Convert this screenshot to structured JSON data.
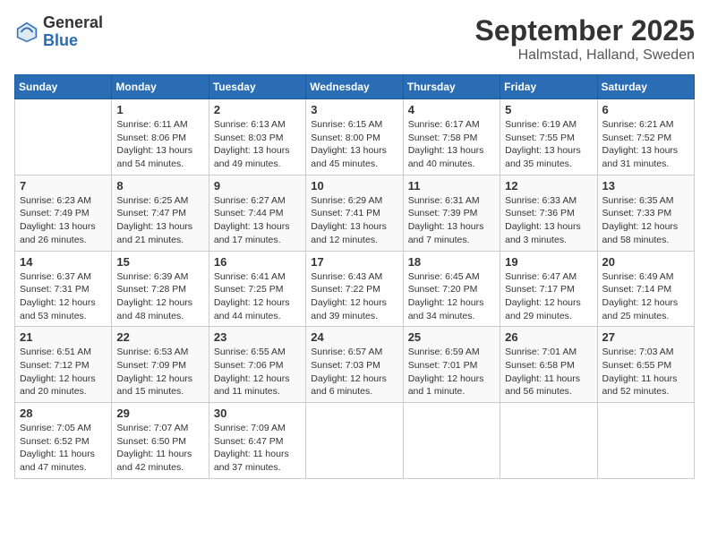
{
  "logo": {
    "general": "General",
    "blue": "Blue"
  },
  "header": {
    "month": "September 2025",
    "location": "Halmstad, Halland, Sweden"
  },
  "weekdays": [
    "Sunday",
    "Monday",
    "Tuesday",
    "Wednesday",
    "Thursday",
    "Friday",
    "Saturday"
  ],
  "weeks": [
    [
      {
        "day": "",
        "info": ""
      },
      {
        "day": "1",
        "info": "Sunrise: 6:11 AM\nSunset: 8:06 PM\nDaylight: 13 hours\nand 54 minutes."
      },
      {
        "day": "2",
        "info": "Sunrise: 6:13 AM\nSunset: 8:03 PM\nDaylight: 13 hours\nand 49 minutes."
      },
      {
        "day": "3",
        "info": "Sunrise: 6:15 AM\nSunset: 8:00 PM\nDaylight: 13 hours\nand 45 minutes."
      },
      {
        "day": "4",
        "info": "Sunrise: 6:17 AM\nSunset: 7:58 PM\nDaylight: 13 hours\nand 40 minutes."
      },
      {
        "day": "5",
        "info": "Sunrise: 6:19 AM\nSunset: 7:55 PM\nDaylight: 13 hours\nand 35 minutes."
      },
      {
        "day": "6",
        "info": "Sunrise: 6:21 AM\nSunset: 7:52 PM\nDaylight: 13 hours\nand 31 minutes."
      }
    ],
    [
      {
        "day": "7",
        "info": "Sunrise: 6:23 AM\nSunset: 7:49 PM\nDaylight: 13 hours\nand 26 minutes."
      },
      {
        "day": "8",
        "info": "Sunrise: 6:25 AM\nSunset: 7:47 PM\nDaylight: 13 hours\nand 21 minutes."
      },
      {
        "day": "9",
        "info": "Sunrise: 6:27 AM\nSunset: 7:44 PM\nDaylight: 13 hours\nand 17 minutes."
      },
      {
        "day": "10",
        "info": "Sunrise: 6:29 AM\nSunset: 7:41 PM\nDaylight: 13 hours\nand 12 minutes."
      },
      {
        "day": "11",
        "info": "Sunrise: 6:31 AM\nSunset: 7:39 PM\nDaylight: 13 hours\nand 7 minutes."
      },
      {
        "day": "12",
        "info": "Sunrise: 6:33 AM\nSunset: 7:36 PM\nDaylight: 13 hours\nand 3 minutes."
      },
      {
        "day": "13",
        "info": "Sunrise: 6:35 AM\nSunset: 7:33 PM\nDaylight: 12 hours\nand 58 minutes."
      }
    ],
    [
      {
        "day": "14",
        "info": "Sunrise: 6:37 AM\nSunset: 7:31 PM\nDaylight: 12 hours\nand 53 minutes."
      },
      {
        "day": "15",
        "info": "Sunrise: 6:39 AM\nSunset: 7:28 PM\nDaylight: 12 hours\nand 48 minutes."
      },
      {
        "day": "16",
        "info": "Sunrise: 6:41 AM\nSunset: 7:25 PM\nDaylight: 12 hours\nand 44 minutes."
      },
      {
        "day": "17",
        "info": "Sunrise: 6:43 AM\nSunset: 7:22 PM\nDaylight: 12 hours\nand 39 minutes."
      },
      {
        "day": "18",
        "info": "Sunrise: 6:45 AM\nSunset: 7:20 PM\nDaylight: 12 hours\nand 34 minutes."
      },
      {
        "day": "19",
        "info": "Sunrise: 6:47 AM\nSunset: 7:17 PM\nDaylight: 12 hours\nand 29 minutes."
      },
      {
        "day": "20",
        "info": "Sunrise: 6:49 AM\nSunset: 7:14 PM\nDaylight: 12 hours\nand 25 minutes."
      }
    ],
    [
      {
        "day": "21",
        "info": "Sunrise: 6:51 AM\nSunset: 7:12 PM\nDaylight: 12 hours\nand 20 minutes."
      },
      {
        "day": "22",
        "info": "Sunrise: 6:53 AM\nSunset: 7:09 PM\nDaylight: 12 hours\nand 15 minutes."
      },
      {
        "day": "23",
        "info": "Sunrise: 6:55 AM\nSunset: 7:06 PM\nDaylight: 12 hours\nand 11 minutes."
      },
      {
        "day": "24",
        "info": "Sunrise: 6:57 AM\nSunset: 7:03 PM\nDaylight: 12 hours\nand 6 minutes."
      },
      {
        "day": "25",
        "info": "Sunrise: 6:59 AM\nSunset: 7:01 PM\nDaylight: 12 hours\nand 1 minute."
      },
      {
        "day": "26",
        "info": "Sunrise: 7:01 AM\nSunset: 6:58 PM\nDaylight: 11 hours\nand 56 minutes."
      },
      {
        "day": "27",
        "info": "Sunrise: 7:03 AM\nSunset: 6:55 PM\nDaylight: 11 hours\nand 52 minutes."
      }
    ],
    [
      {
        "day": "28",
        "info": "Sunrise: 7:05 AM\nSunset: 6:52 PM\nDaylight: 11 hours\nand 47 minutes."
      },
      {
        "day": "29",
        "info": "Sunrise: 7:07 AM\nSunset: 6:50 PM\nDaylight: 11 hours\nand 42 minutes."
      },
      {
        "day": "30",
        "info": "Sunrise: 7:09 AM\nSunset: 6:47 PM\nDaylight: 11 hours\nand 37 minutes."
      },
      {
        "day": "",
        "info": ""
      },
      {
        "day": "",
        "info": ""
      },
      {
        "day": "",
        "info": ""
      },
      {
        "day": "",
        "info": ""
      }
    ]
  ]
}
